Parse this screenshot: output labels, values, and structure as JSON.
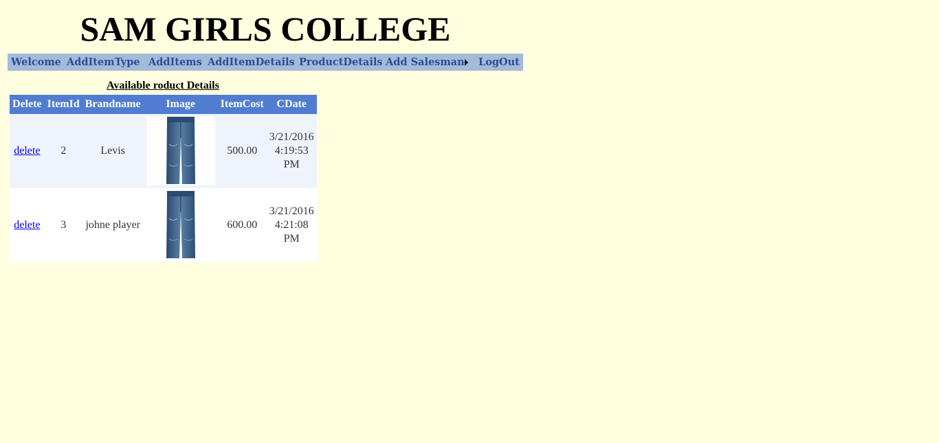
{
  "header": {
    "title": "SAM GIRLS COLLEGE"
  },
  "menu": {
    "items": [
      {
        "label": "Welcome"
      },
      {
        "label": "AddItemType"
      },
      {
        "label": "AddItems"
      },
      {
        "label": "AddItemDetails"
      },
      {
        "label": "ProductDetails"
      },
      {
        "label": "Add Salesman"
      },
      {
        "label": "LogOut"
      }
    ],
    "colors": {
      "bar": "#a4bbd8",
      "text": "#284e98"
    }
  },
  "main": {
    "section_title": "Available roduct Details",
    "table": {
      "headers": [
        "Delete",
        "ItemId",
        "Brandname",
        "Image",
        "ItemCost",
        "CDate"
      ],
      "rows": [
        {
          "delete_label": "delete",
          "item_id": "2",
          "brandname": "Levis",
          "image": "jeans-image",
          "item_cost": "500.00",
          "cdate": {
            "date": "3/21/2016",
            "time": "4:19:53",
            "ampm": "PM"
          }
        },
        {
          "delete_label": "delete",
          "item_id": "3",
          "brandname": "johne player",
          "image": "jeans-image",
          "item_cost": "600.00",
          "cdate": {
            "date": "3/21/2016",
            "time": "4:21:08",
            "ampm": "PM"
          }
        }
      ],
      "colors": {
        "header": "#507cd1",
        "row_alt": "#eff3fb",
        "row": "#ffffff"
      }
    }
  }
}
